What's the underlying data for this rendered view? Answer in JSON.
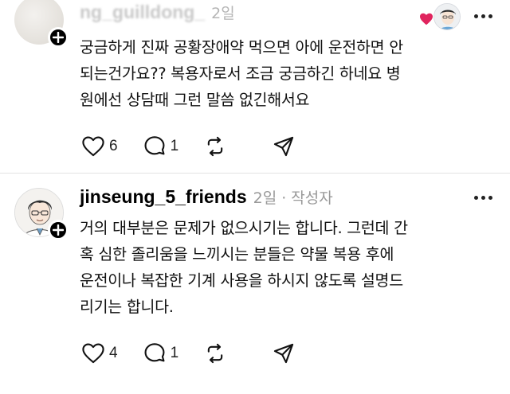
{
  "top_post": {
    "username": "ng_guilldong_",
    "time": "2일",
    "body_lines": [
      "궁금하게 진짜 공황장애약 먹으면 아에 운전하면 안",
      "되는건가요?? 복용자로서 조금 궁금하긴 하네요 병",
      "원에선 상담때 그런 말씀 없긴해서요"
    ],
    "likes": "6",
    "replies": "1",
    "icons": [
      "heart-icon",
      "comment-icon",
      "repost-icon",
      "share-icon"
    ],
    "liked_by_author_heart_color": "#e0245e"
  },
  "reply_post": {
    "username": "jinseung_5_friends",
    "time": "2일",
    "separator": "·",
    "author_tag": "작성자",
    "body_lines": [
      "거의 대부분은 문제가 없으시기는 합니다. 그런데 간",
      "혹 심한 졸리움을 느끼시는 분들은 약물 복용 후에",
      "운전이나 복잡한 기계 사용을 하시지 않도록 설명드",
      "리기는 합니다."
    ],
    "likes": "4",
    "replies": "1",
    "icons": [
      "heart-icon",
      "comment-icon",
      "repost-icon",
      "share-icon"
    ]
  }
}
